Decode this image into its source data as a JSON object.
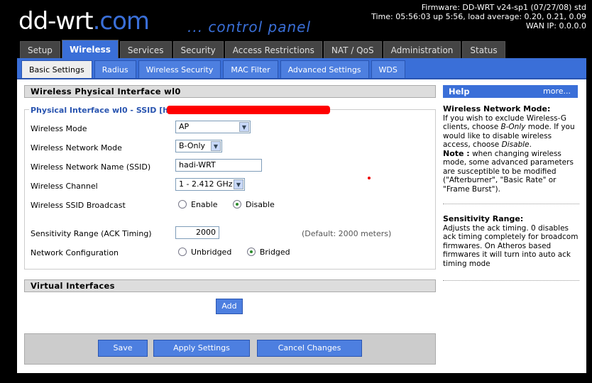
{
  "header": {
    "logo_main": "dd-wrt",
    "logo_dot": ".com",
    "logo_tagline": "... control panel",
    "firmware": "Firmware: DD-WRT v24-sp1 (07/27/08) std",
    "time": "Time: 05:56:03 up 5:56, load average: 0.20, 0.21, 0.09",
    "wan_ip": "WAN IP: 0.0.0.0"
  },
  "tabs": [
    "Setup",
    "Wireless",
    "Services",
    "Security",
    "Access Restrictions",
    "NAT / QoS",
    "Administration",
    "Status"
  ],
  "subtabs": [
    "Basic Settings",
    "Radius",
    "Wireless Security",
    "MAC Filter",
    "Advanced Settings",
    "WDS"
  ],
  "main": {
    "section_title": "Wireless Physical Interface wl0",
    "legend": "Physical Interface wl0 - SSID [ha",
    "wireless_mode_label": "Wireless Mode",
    "wireless_mode_value": "AP",
    "network_mode_label": "Wireless Network Mode",
    "network_mode_value": "B-Only",
    "ssid_label": "Wireless Network Name (SSID)",
    "ssid_value": "hadi-WRT",
    "channel_label": "Wireless Channel",
    "channel_value": "1 - 2.412 GHz",
    "broadcast_label": "Wireless SSID Broadcast",
    "broadcast_enable": "Enable",
    "broadcast_disable": "Disable",
    "sensitivity_label": "Sensitivity Range (ACK Timing)",
    "sensitivity_value": "2000",
    "sensitivity_default": "(Default: 2000 meters)",
    "netconfig_label": "Network Configuration",
    "netconfig_unbridged": "Unbridged",
    "netconfig_bridged": "Bridged",
    "virtual_title": "Virtual Interfaces",
    "add_label": "Add"
  },
  "footer": {
    "save": "Save",
    "apply": "Apply Settings",
    "cancel": "Cancel Changes"
  },
  "help": {
    "title": "Help",
    "more": "more...",
    "mode_heading": "Wireless Network Mode:",
    "mode_text_1": "If you wish to exclude Wireless-G clients, choose",
    "mode_em_1": "B-Only",
    "mode_text_2": "mode. If you would like to disable wireless access, choose",
    "mode_em_2": "Disable",
    "note_label": "Note :",
    "note_text": "when changing wireless mode, some advanced parameters are susceptible to be modified (\"Afterburner\", \"Basic Rate\" or \"Frame Burst\").",
    "sens_heading": "Sensitivity Range:",
    "sens_text": "Adjusts the ack timing. 0 disables ack timing completely for broadcom firmwares. On Atheros based firmwares it will turn into auto ack timing mode"
  }
}
